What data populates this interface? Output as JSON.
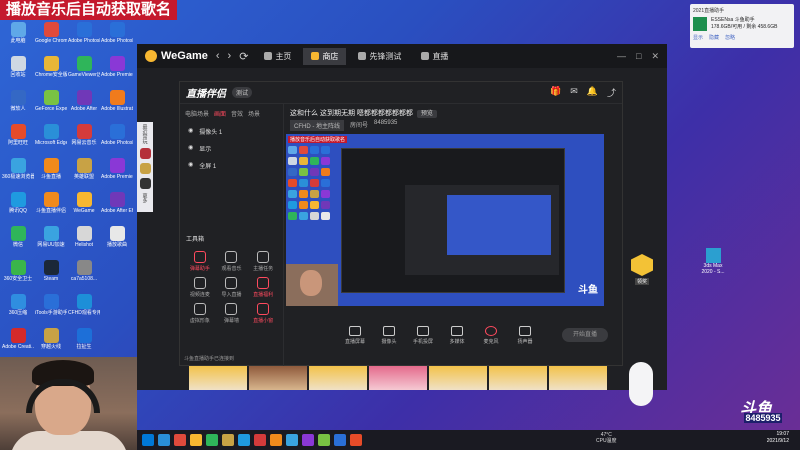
{
  "banner": "播放音乐后自动获取歌名",
  "desktop_icons": [
    {
      "label": "此电脑",
      "color": "#5fa8e8"
    },
    {
      "label": "Google Chrome",
      "color": "#e04a3c"
    },
    {
      "label": "Adobe Photosh...",
      "color": "#2a6fd8"
    },
    {
      "label": "Adobe Photosh...",
      "color": "#2a6fd8"
    },
    {
      "label": "回收站",
      "color": "#cfd8e3"
    },
    {
      "label": "Chrome安全版",
      "color": "#e8b637"
    },
    {
      "label": "GameViewer远程",
      "color": "#2fb55a"
    },
    {
      "label": "Adobe Premiere",
      "color": "#8a38d6"
    },
    {
      "label": "微软人",
      "color": "#3468c5"
    },
    {
      "label": "GeForce Experience",
      "color": "#79c243"
    },
    {
      "label": "Adobe After",
      "color": "#7038b8"
    },
    {
      "label": "Adobe Illustrator",
      "color": "#f07b1c"
    },
    {
      "label": "阿里旺旺",
      "color": "#e64b29"
    },
    {
      "label": "Microsoft Edge",
      "color": "#2a8fd8"
    },
    {
      "label": "网易云音乐",
      "color": "#d43b3b"
    },
    {
      "label": "Adobe Photosh...",
      "color": "#2a6fd8"
    },
    {
      "label": "360极速浏览器",
      "color": "#3aa3e0"
    },
    {
      "label": "斗鱼直播",
      "color": "#f08a1c"
    },
    {
      "label": "英雄联盟",
      "color": "#c8a245"
    },
    {
      "label": "Adobe Premiere",
      "color": "#8a38d6"
    },
    {
      "label": "腾讯QQ",
      "color": "#1f9ae0"
    },
    {
      "label": "斗鱼直播伴侣",
      "color": "#f08a1c"
    },
    {
      "label": "WeGame",
      "color": "#f7b731"
    },
    {
      "label": "Adobe After Effects",
      "color": "#7038b8"
    },
    {
      "label": "微信",
      "color": "#2fb55a"
    },
    {
      "label": "网易UU加速",
      "color": "#3aa3e0"
    },
    {
      "label": "Helishot",
      "color": "#d7d7d7"
    },
    {
      "label": "播放歌曲",
      "color": "#e8e8e8"
    },
    {
      "label": "360安全卫士",
      "color": "#3ab54a"
    },
    {
      "label": "Steam",
      "color": "#1b2838"
    },
    {
      "label": "ca7a5108...",
      "color": "#888888"
    },
    {
      "label": "",
      "color": "transparent"
    },
    {
      "label": "360压缩",
      "color": "#2f8ee0"
    },
    {
      "label": "iTools手游助手",
      "color": "#2a6fd8"
    },
    {
      "label": "CFHD观看专用加速器",
      "color": "#1d8fd8"
    },
    {
      "label": "",
      "color": "transparent"
    },
    {
      "label": "Adobe Creati...",
      "color": "#d42a2a"
    },
    {
      "label": "穿越火线",
      "color": "#c8a245"
    },
    {
      "label": "拉扯生",
      "color": "#1d6fd8"
    },
    {
      "label": "",
      "color": "transparent"
    }
  ],
  "wegame": {
    "logo": "WeGame",
    "nav_back": "‹",
    "nav_fwd": "›",
    "nav_refresh": "⟳",
    "tabs": [
      {
        "label": "主页",
        "active": false
      },
      {
        "label": "商店",
        "active": true
      },
      {
        "label": "先锋测试",
        "active": false
      },
      {
        "label": "直播",
        "active": false
      }
    ],
    "win_min": "—",
    "win_max": "□",
    "win_close": "✕",
    "side_label": "最近常玩",
    "side_more": "更多"
  },
  "zhibo": {
    "logo": "直播伴侣",
    "version": "测试",
    "left_tabs": [
      {
        "label": "电脑场景",
        "active": false
      },
      {
        "label": "画面",
        "active": true
      },
      {
        "label": "音效",
        "active": false
      },
      {
        "label": "场景",
        "active": false
      }
    ],
    "scenes": [
      "摄像头 1",
      "显示",
      "全屏 1"
    ],
    "tools_title": "工具箱",
    "tools": [
      {
        "label": "弹幕助手",
        "red": true
      },
      {
        "label": "观看音乐",
        "red": false
      },
      {
        "label": "主播任务",
        "red": false
      },
      {
        "label": "视频连麦",
        "red": false
      },
      {
        "label": "导入直播",
        "red": false
      },
      {
        "label": "直播福利",
        "red": true
      },
      {
        "label": "虚拟形象",
        "red": false
      },
      {
        "label": "弹幕墙",
        "red": false
      },
      {
        "label": "直播小窗",
        "red": true
      }
    ],
    "footer": "斗鱼直播助手已连接到",
    "stream_title": "这和什么 这到期无期 嗯都都都都都都都",
    "tag": "预览",
    "game": "CFHD - 地主阵线",
    "room_label": "房间号",
    "room_id": "8485935",
    "controls": [
      {
        "label": "直播屏幕"
      },
      {
        "label": "摄像头"
      },
      {
        "label": "手机投屏"
      },
      {
        "label": "多媒体"
      },
      {
        "label": "麦克风"
      },
      {
        "label": "扬声器"
      }
    ],
    "go_live": "开始直播",
    "preview_banner": "播放音乐后自动获取歌名",
    "preview_logo": "斗鱼",
    "badge_label": "领奖"
  },
  "notification": {
    "header": "2021直播助手",
    "line1": "ESSENsa 斗鱼助手",
    "line2": "178.6GB/可用 / 剩余 458.6GB",
    "links": [
      "显示",
      "隐藏",
      "忽略"
    ]
  },
  "desktop_right_icon": {
    "label": "3ds Max 2020 - S..."
  },
  "stream_logo": "斗鱼",
  "stream_room": "8485935",
  "tray": {
    "temp": "47°C",
    "cpu": "CPU温度"
  },
  "clock": {
    "time": "19:07",
    "date": "2021/9/12"
  },
  "taskbar_icons": [
    "#2a8fd8",
    "#e04a3c",
    "#f7b731",
    "#2fb55a",
    "#c8a245",
    "#1f9ae0",
    "#d43b3b",
    "#f08a1c",
    "#3aa3e0",
    "#8a38d6",
    "#79c243",
    "#2a6fd8",
    "#e64b29"
  ]
}
